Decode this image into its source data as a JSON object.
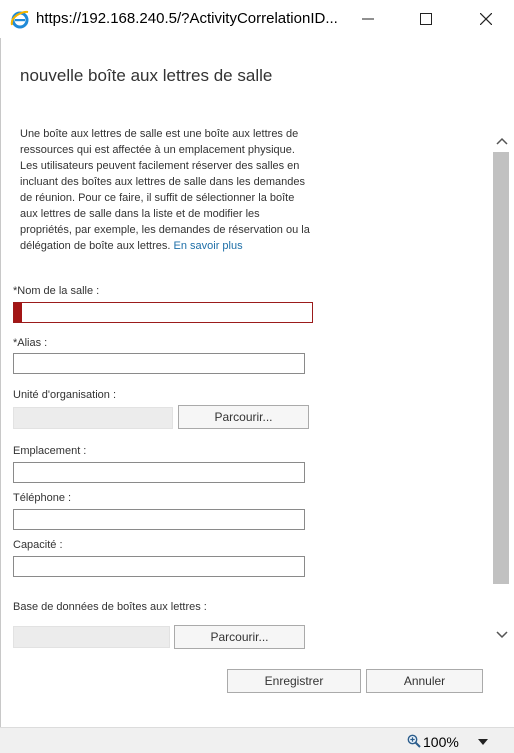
{
  "window": {
    "url": "https://192.168.240.5/?ActivityCorrelationID...",
    "icon": "internet-explorer-icon",
    "controls": [
      "minimize-icon",
      "maximize-icon",
      "close-icon"
    ]
  },
  "dialog": {
    "title": "nouvelle boîte aux lettres de salle",
    "description": "Une boîte aux lettres de salle est une boîte aux lettres de ressources qui est affectée à un emplacement physique. Les utilisateurs peuvent facilement réserver des salles en incluant des boîtes aux lettres de salle dans les demandes de réunion. Pour ce faire, il suffit de sélectionner la boîte aux lettres de salle dans la liste et de modifier les propriétés, par exemple, les demandes de réservation ou la délégation de boîte aux lettres.",
    "learn_more": "En savoir plus",
    "fields": {
      "room_name": {
        "label": "*Nom de la salle :",
        "value": ""
      },
      "alias": {
        "label": "*Alias :",
        "value": ""
      },
      "org_unit": {
        "label": "Unité d'organisation :",
        "value": "",
        "browse": "Parcourir..."
      },
      "location": {
        "label": "Emplacement :",
        "value": ""
      },
      "phone": {
        "label": "Téléphone :",
        "value": ""
      },
      "capacity": {
        "label": "Capacité :",
        "value": ""
      },
      "database": {
        "label": "Base de données de boîtes aux lettres :",
        "value": "",
        "browse": "Parcourir..."
      }
    },
    "save_label": "Enregistrer",
    "cancel_label": "Annuler"
  },
  "status": {
    "zoom": "100%"
  },
  "colors": {
    "link": "#1e6fa8",
    "error": "#a31515",
    "scrollbar": "#c1c1c1"
  }
}
